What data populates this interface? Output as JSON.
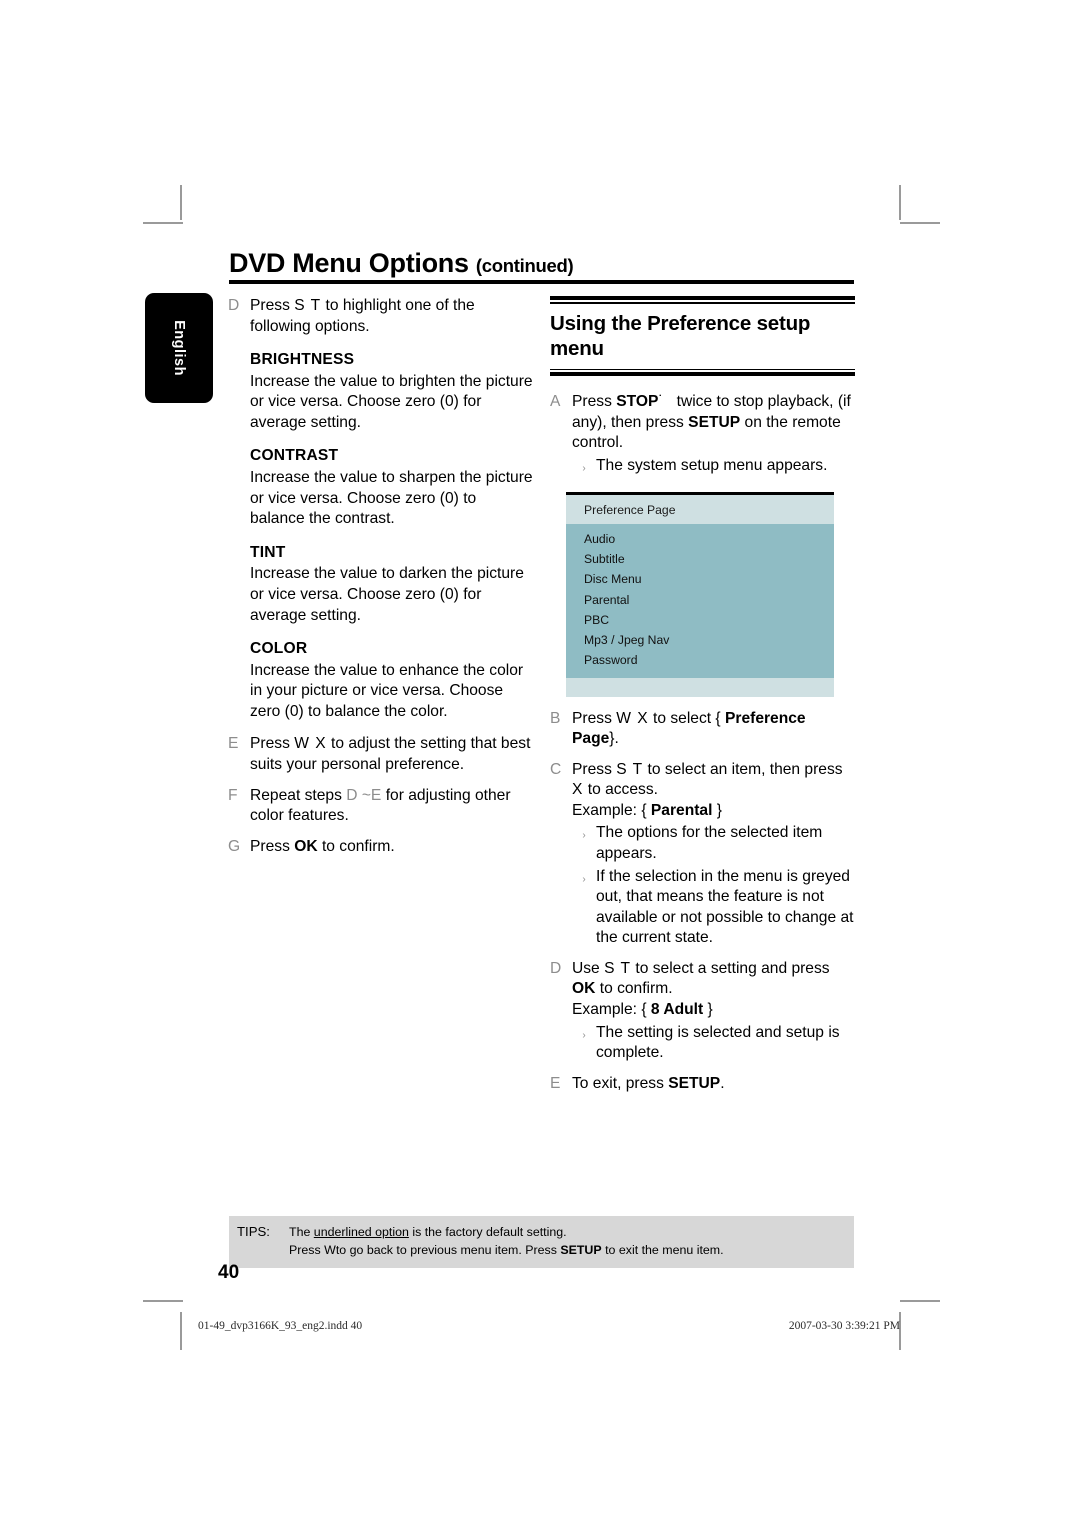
{
  "page": {
    "heading_main": "DVD Menu Options",
    "heading_continued": "(continued)",
    "language_tab": "English",
    "page_number": "40"
  },
  "left_column": {
    "step_d": {
      "letter": "D",
      "text_before": "Press",
      "keys": "S  T",
      "text_after": "to highlight one of the following options."
    },
    "options": [
      {
        "name": "BRIGHTNESS",
        "description": "Increase the value to brighten the picture or vice versa. Choose zero (0) for average setting."
      },
      {
        "name": "CONTRAST",
        "description": "Increase the value to sharpen the picture or vice versa.  Choose zero (0) to balance the contrast."
      },
      {
        "name": "TINT",
        "description": "Increase the value to darken the picture or vice versa.  Choose zero (0) for average setting."
      },
      {
        "name": "COLOR",
        "description": "Increase the value to enhance the color in your picture or vice versa. Choose zero (0) to balance the color."
      }
    ],
    "step_e": {
      "letter": "E",
      "text_before": "Press",
      "keys": "W X",
      "text_after": "to adjust the setting that best suits your personal preference."
    },
    "step_f": {
      "letter": "F",
      "text_before": "Repeat steps",
      "keys": "D ~E",
      "text_after": "for adjusting other color features."
    },
    "step_g": {
      "letter": "G",
      "text_before": "Press",
      "bold": "OK",
      "text_after": "to confirm."
    }
  },
  "right_column": {
    "section_title": "Using the Preference setup menu",
    "step_a": {
      "letter": "A",
      "text_1": "Press",
      "bold_1": "STOP",
      "symbol": "˙",
      "text_2": "twice to stop playback, (if any), then press",
      "bold_2": "SETUP",
      "text_3": "on the remote control.",
      "bullet": "The system setup menu appears."
    },
    "osd_menu": {
      "title": "Preference Page",
      "items": [
        "Audio",
        "Subtitle",
        "Disc Menu",
        "Parental",
        "PBC",
        "Mp3 / Jpeg Nav",
        "Password"
      ],
      "header_color": "#cfe0e2",
      "body_color": "#8fbcc4"
    },
    "step_b": {
      "letter": "B",
      "text_before": "Press",
      "keys": "W X",
      "text_mid": "to select {",
      "bold": "Preference Page",
      "text_after": "}."
    },
    "step_c": {
      "letter": "C",
      "text_before": "Press",
      "keys": "S  T",
      "text_mid": "to select an item, then press",
      "key_2": "X",
      "text_after": "to access.",
      "example_label": "Example: {",
      "example_bold": "Parental",
      "example_close": "}",
      "bullets": [
        "The options for the selected item appears.",
        "If the selection in the menu is greyed out, that means the feature is not available or not possible to change at the current state."
      ]
    },
    "step_d": {
      "letter": "D",
      "text_before": "Use",
      "keys": "S  T",
      "text_mid": "to select a setting and press",
      "bold": "OK",
      "text_after": "to confirm.",
      "example_label": "Example: {",
      "example_bold": "8 Adult",
      "example_close": "}",
      "bullet": "The setting is selected and setup is complete."
    },
    "step_e": {
      "letter": "E",
      "text_before": "To exit, press",
      "bold": "SETUP",
      "text_after": "."
    }
  },
  "tips": {
    "label": "TIPS:",
    "line1_before": "The ",
    "line1_underlined": "underlined option",
    "line1_after": " is the factory default setting.",
    "line2_before": "Press  W",
    "line2_mid": "to go back to previous menu item. Press ",
    "line2_bold": "SETUP",
    "line2_after": " to exit the menu item."
  },
  "footer": {
    "file_info": "01-49_dvp3166K_93_eng2.indd   40",
    "timestamp": "2007-03-30   3:39:21 PM"
  }
}
